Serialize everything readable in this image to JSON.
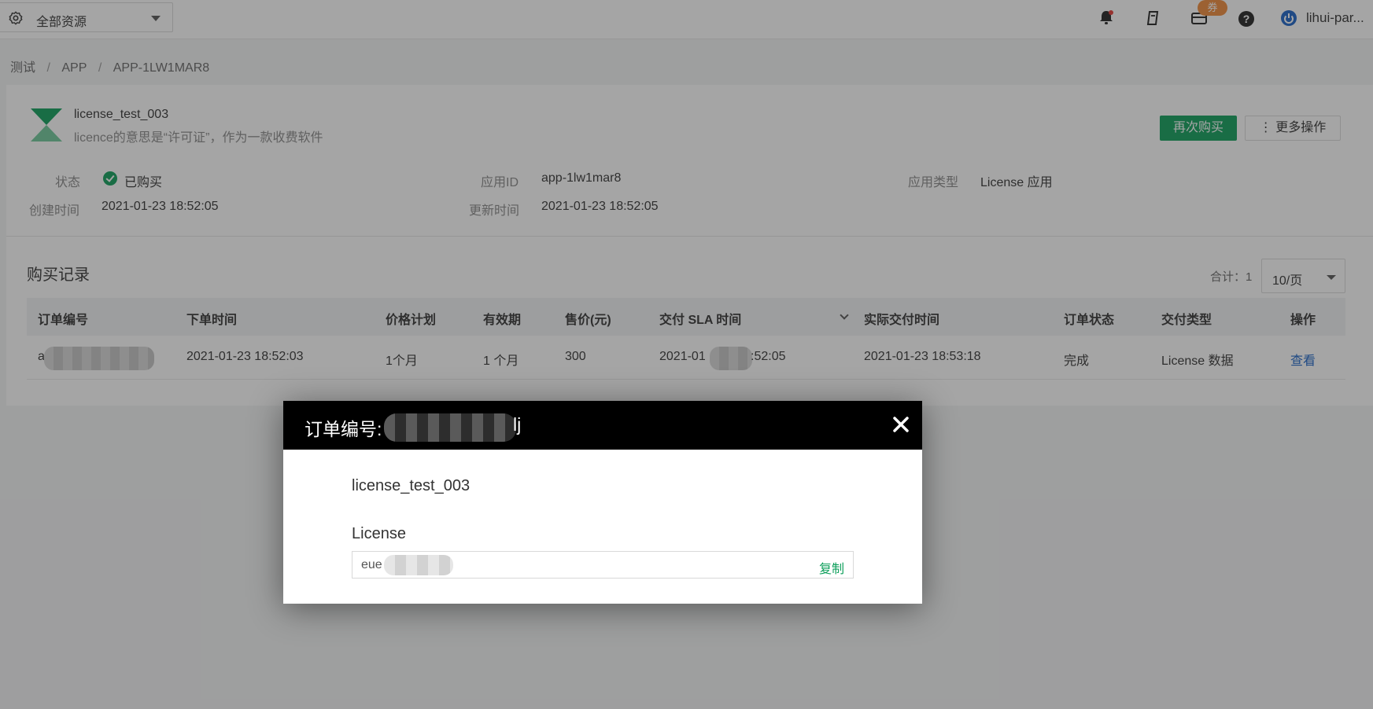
{
  "header": {
    "resource_select": "全部资源",
    "coupon_badge": "券",
    "user": "lihui-par..."
  },
  "breadcrumb": [
    "测试",
    "APP",
    "APP-1LW1MAR8"
  ],
  "app": {
    "name": "license_test_003",
    "description": "licence的意思是“许可证”，作为一款收费软件",
    "buy_again": "再次购买",
    "more_actions": "⋮ 更多操作",
    "status_label": "状态",
    "status_value": "已购买",
    "created_label": "创建时间",
    "created_value": "2021-01-23 18:52:05",
    "appid_label": "应用ID",
    "appid_value": "app-1lw1mar8",
    "updated_label": "更新时间",
    "updated_value": "2021-01-23 18:52:05",
    "type_label": "应用类型",
    "type_value": "License 应用"
  },
  "records": {
    "title": "购买记录",
    "total": "合计：1",
    "page_size": "10/页",
    "columns": [
      "订单编号",
      "下单时间",
      "价格计划",
      "有效期",
      "售价(元)",
      "交付 SLA 时间",
      "实际交付时间",
      "订单状态",
      "交付类型",
      "操作"
    ],
    "rows": [
      {
        "order_id_visible": "a",
        "order_time": "2021-01-23 18:52:03",
        "plan": "1个月",
        "validity": "1 个月",
        "price": "300",
        "sla_prefix": "2021-01",
        "sla_suffix": ":52:05",
        "delivered": "2021-01-23 18:53:18",
        "status": "完成",
        "delivery_type": "License 数据",
        "action": "查看"
      }
    ]
  },
  "modal": {
    "title_prefix": "订单编号: a",
    "title_suffix": "lj",
    "app_name": "license_test_003",
    "license_label": "License",
    "license_value_visible": "eue",
    "copy": "复制"
  }
}
